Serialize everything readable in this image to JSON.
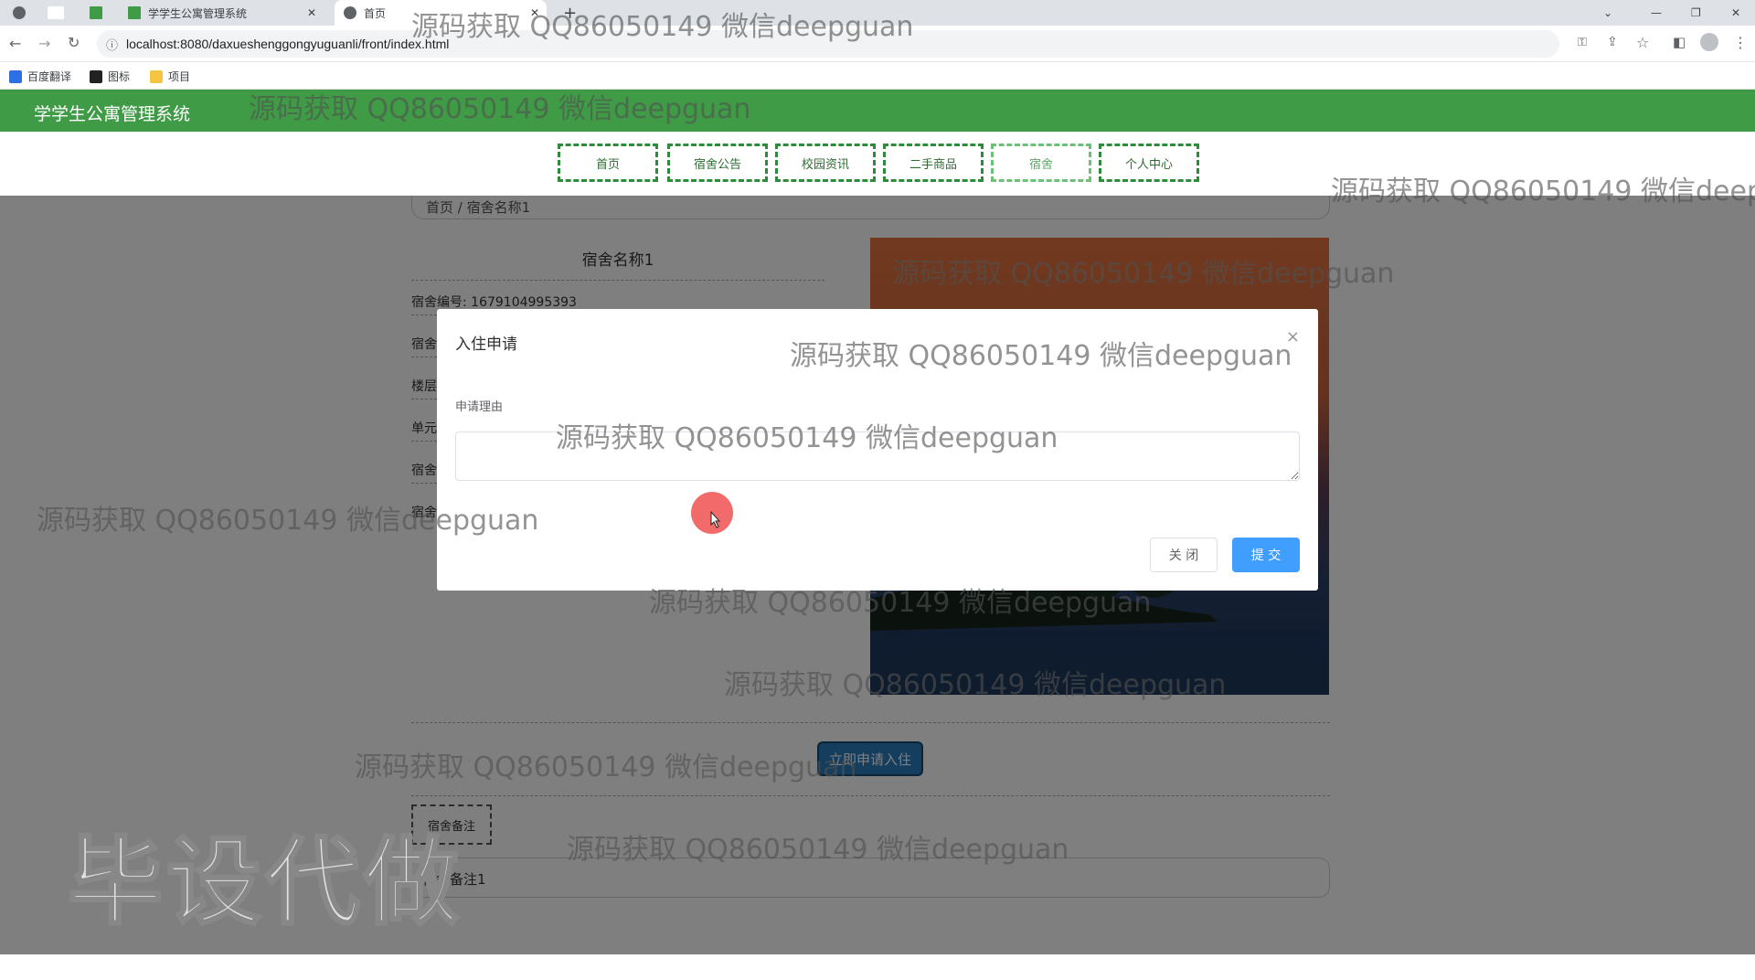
{
  "browser": {
    "tabs": [
      {
        "label": ""
      },
      {
        "label": ""
      },
      {
        "label": ""
      },
      {
        "label": "学学生公寓管理系统"
      },
      {
        "label": "首页"
      }
    ],
    "new_tab_symbol": "+",
    "url": "localhost:8080/daxueshenggongyuguanli/front/index.html",
    "bookmarks": [
      "百度翻译",
      "图标",
      "项目"
    ]
  },
  "site": {
    "title": "学学生公寓管理系统",
    "nav": [
      "首页",
      "宿舍公告",
      "校园资讯",
      "二手商品",
      "宿舍",
      "个人中心"
    ]
  },
  "page": {
    "breadcrumb": "首页 / 宿舍名称1",
    "room_title": "宿舍名称1",
    "info_rows": [
      "宿舍编号: 1679104995393",
      "宿舍",
      "楼层",
      "单元",
      "宿舍",
      "宿舍"
    ],
    "apply_button": "立即申请入住",
    "remark_label": "宿舍备注",
    "remark_value": "宿舍备注1"
  },
  "modal": {
    "title": "入住申请",
    "close_symbol": "×",
    "field_label": "申请理由",
    "field_value": "",
    "cancel_label": "关 闭",
    "submit_label": "提 交"
  },
  "watermarks": {
    "text": "源码获取 QQ86050149 微信deepguan",
    "big": "毕设代做"
  },
  "colors": {
    "header_green": "#3f9b46",
    "primary_blue": "#409eff",
    "overlay": "rgba(0,0,0,0.5)"
  }
}
